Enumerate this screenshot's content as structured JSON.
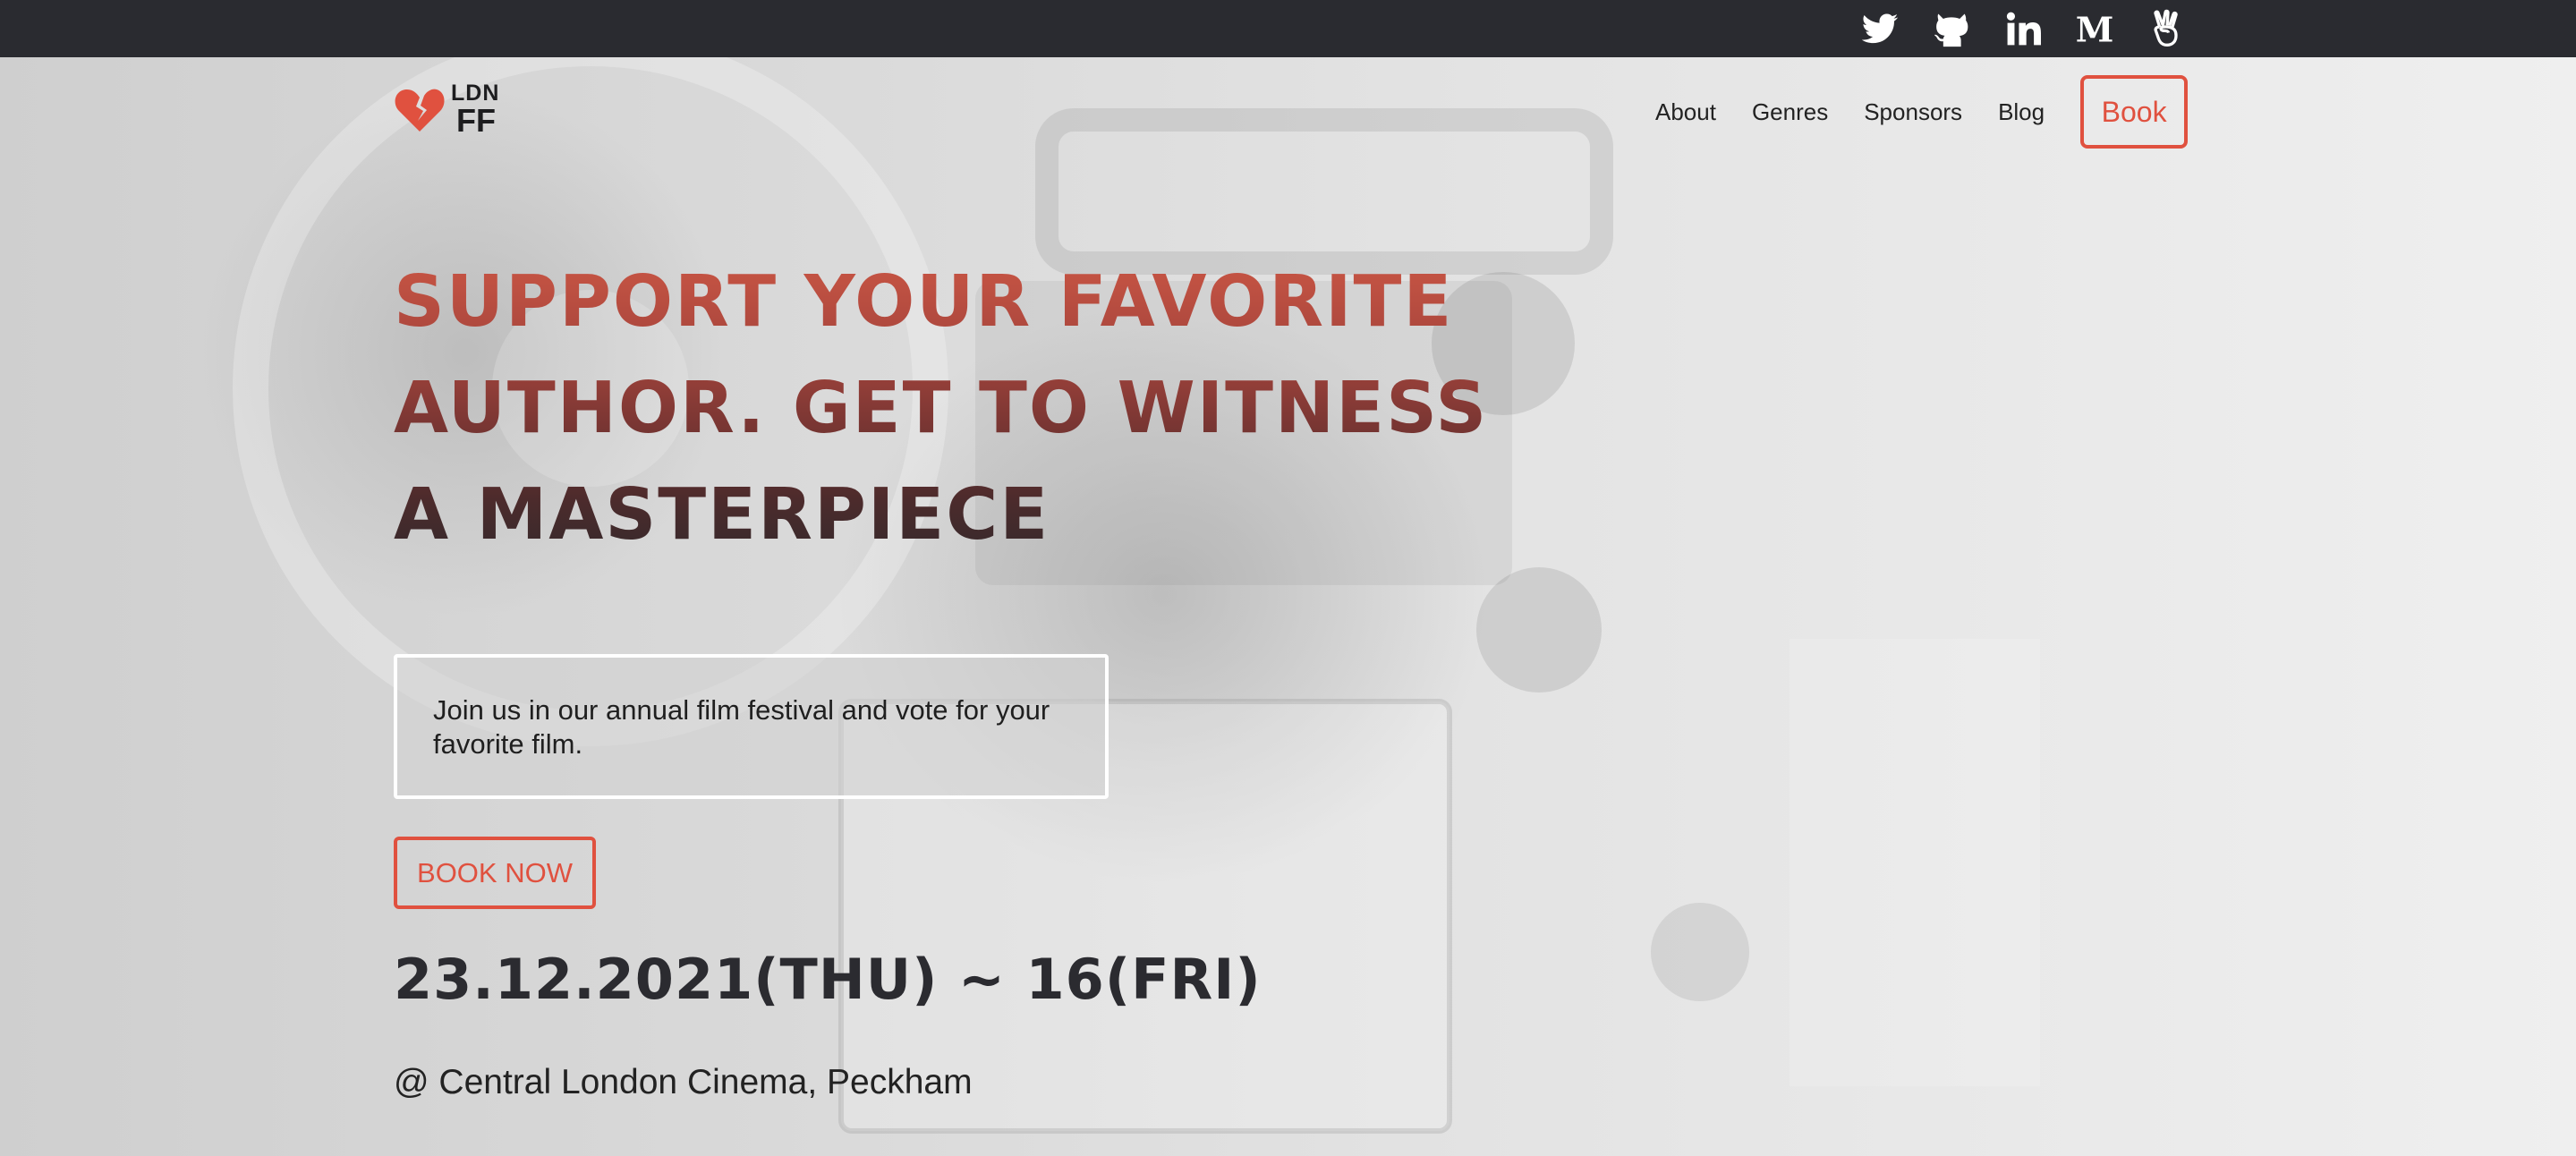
{
  "social": [
    {
      "name": "twitter-icon"
    },
    {
      "name": "github-icon"
    },
    {
      "name": "linkedin-icon"
    },
    {
      "name": "medium-icon"
    },
    {
      "name": "angellist-icon"
    }
  ],
  "logo": {
    "line1": "LDN",
    "line2": "FF",
    "icon": "broken-heart-icon",
    "color": "#e0513f"
  },
  "nav": {
    "about": "About",
    "genres": "Genres",
    "sponsors": "Sponsors",
    "blog": "Blog",
    "book": "Book"
  },
  "hero": {
    "headline": [
      "SUPPORT YOUR FAVORITE",
      "AUTHOR. GET TO WITNESS",
      "A MASTERPIECE"
    ],
    "intro": "Join us in our annual film festival and vote for your favorite film.",
    "cta": "BOOK NOW",
    "dates": "23.12.2021(THU) ~ 16(FRI)",
    "venue": "@ Central London Cinema, Peckham"
  },
  "colors": {
    "accent": "#e0513f",
    "topbar": "#2a2b30"
  }
}
